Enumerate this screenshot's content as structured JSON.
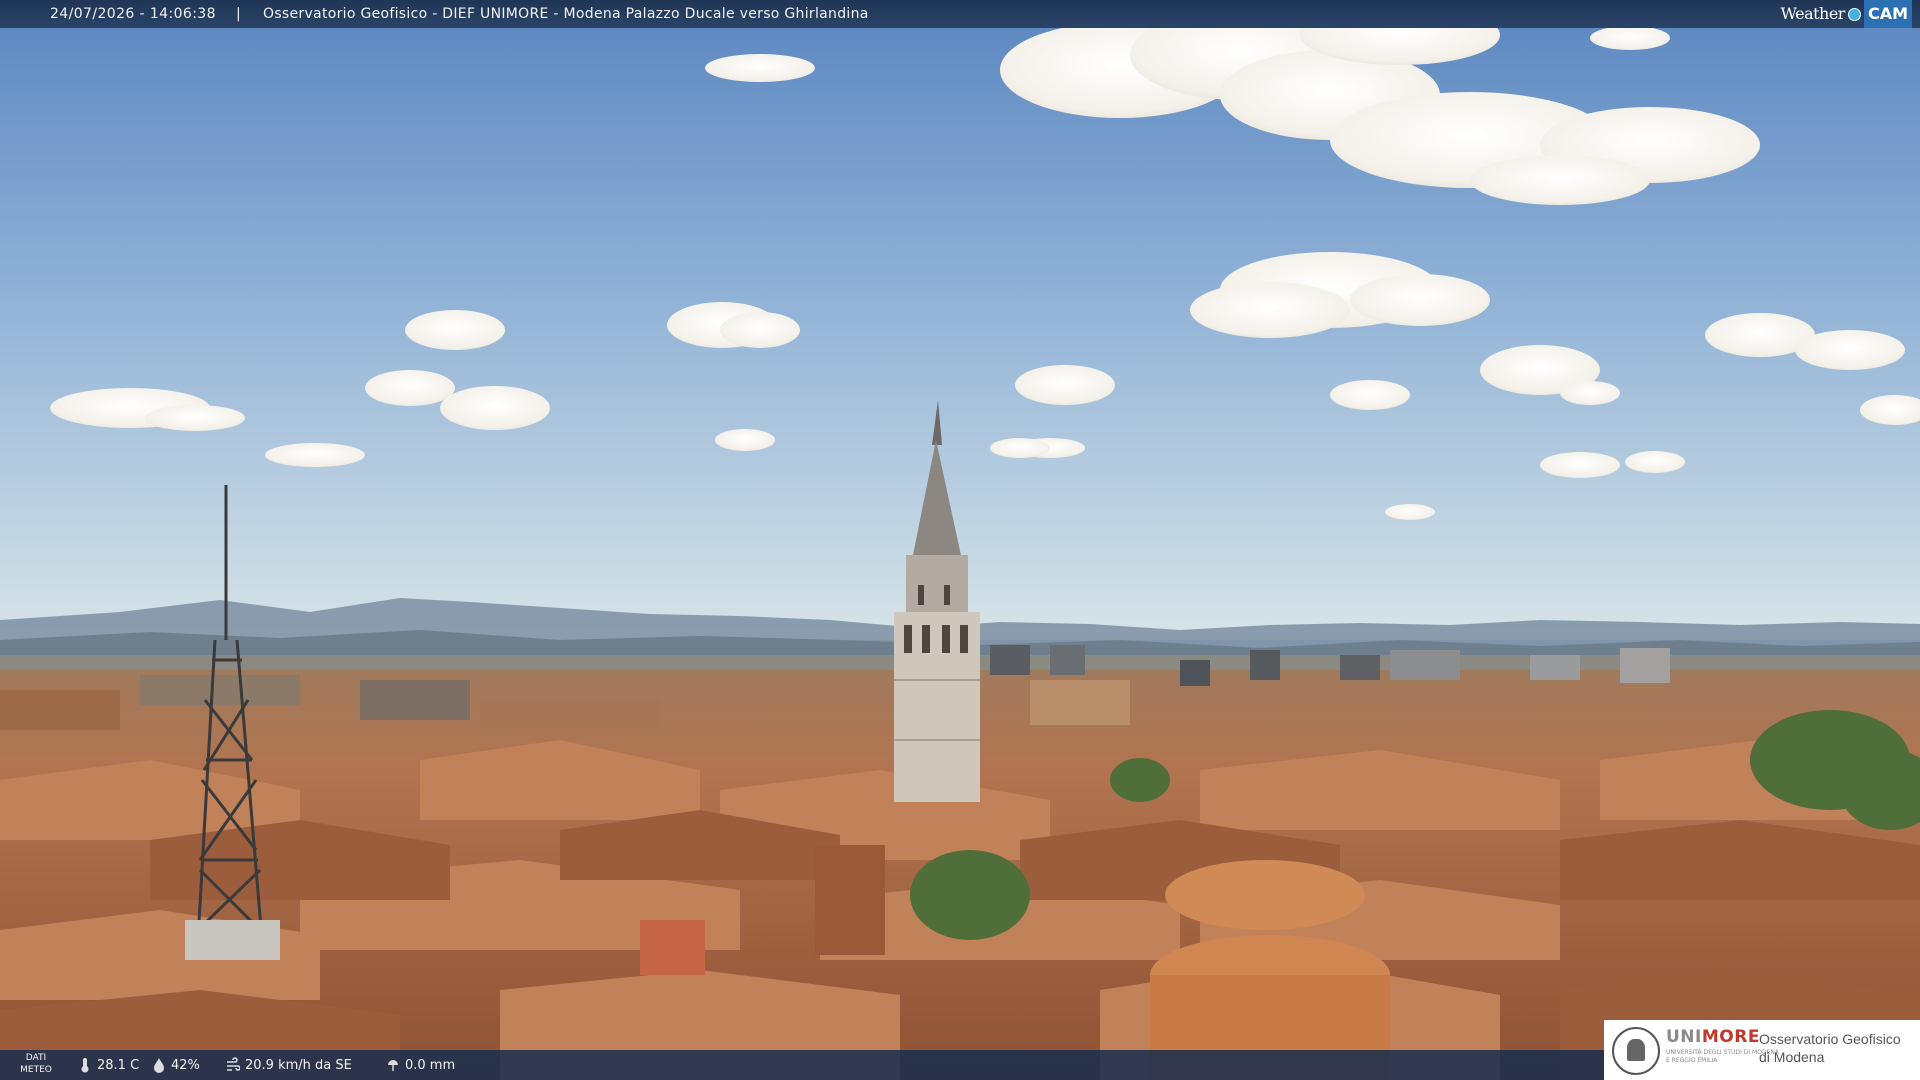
{
  "header": {
    "timestamp": "24/07/2026 - 14:06:38",
    "separator": "|",
    "title": "Osservatorio Geofisico - DIEF UNIMORE - Modena Palazzo Ducale verso Ghirlandina"
  },
  "brand": {
    "weather": "Weather",
    "cam": "CAM"
  },
  "weather_panel": {
    "label_line1": "DATI",
    "label_line2": "METEO",
    "temperature": "28.1 C",
    "humidity": "42%",
    "wind": "20.9 km/h da SE",
    "rain": "0.0 mm",
    "icons": [
      "thermometer-icon",
      "humidity-icon",
      "wind-icon",
      "rain-gauge-icon"
    ]
  },
  "logo": {
    "uni": "UNI",
    "more": "MORE",
    "sub": "UNIVERSITÀ DEGLI STUDI DI MODENA E REGGIO EMILIA",
    "obs_line1": "Osservatorio Geofisico",
    "obs_line2": "di Modena"
  },
  "colors": {
    "sky_top": "#5a86c0",
    "sky_bottom": "#c9dbe6",
    "roof": "#b8774a",
    "bar": "#1f3555",
    "unimore_red": "#c0392b"
  }
}
